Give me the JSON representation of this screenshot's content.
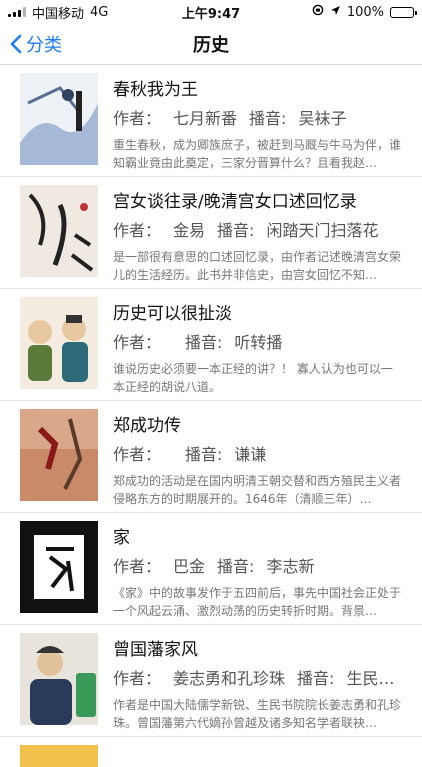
{
  "status": {
    "carrier": "中国移动",
    "network": "4G",
    "time": "上午9:47",
    "battery": "100%"
  },
  "nav": {
    "back_label": "分类",
    "title": "历史"
  },
  "labels": {
    "author": "作者：",
    "narrator": "播音:"
  },
  "books": [
    {
      "title": "春秋我为王",
      "author": "七月新番",
      "narrator": "吴袜子",
      "desc": "重生春秋，成为卿族庶子，被赶到马厩与牛马为伴，谁知霸业竟由此奠定，三家分晋算什么？且看我赵…",
      "cover_color": "#a6b9d6"
    },
    {
      "title": "宫女谈往录/晚清宫女口述回忆录",
      "author": "金易",
      "narrator": "闲踏天门扫落花",
      "desc": "是一部很有意思的口述回忆录，由作者记述晚清宫女荣儿的生活经历。此书并非信史，由宫女回忆不知…",
      "cover_color": "#efe9e1"
    },
    {
      "title": "历史可以很扯淡",
      "author": "",
      "narrator": "听转播",
      "desc": "谁说历史必须要一本正经的讲？！ 寡人认为也可以一本正经的胡说八道。",
      "cover_color": "#d8c7ad"
    },
    {
      "title": "郑成功传",
      "author": "",
      "narrator": "谦谦",
      "desc": "郑成功的活动是在国内明清王朝交替和西方殖民主义者侵略东方的时期展开的。1646年（清顺三年）…",
      "cover_color": "#c98a6a"
    },
    {
      "title": "家",
      "author": "巴金",
      "narrator": "李志新",
      "desc": "《家》中的故事发作于五四前后，事先中国社会正处于一个风起云涌、激烈动荡的历史转折时期。背景…",
      "cover_color": "#111111"
    },
    {
      "title": "曾国藩家风",
      "author": "姜志勇和孔珍珠",
      "narrator": "生民…",
      "desc": "作者是中国大陆儒学新锐、生民书院院长姜志勇和孔珍珠。曾国藩第六代嫡孙曾越及诸多知名学者联袂…",
      "cover_color": "#e8e4dc"
    }
  ]
}
